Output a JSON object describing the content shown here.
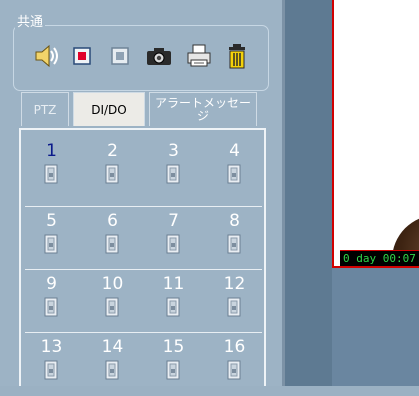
{
  "common": {
    "legend": "共通"
  },
  "toolbar": {
    "items": [
      {
        "icon": "speaker-icon"
      },
      {
        "icon": "record-start-icon"
      },
      {
        "icon": "record-stop-icon"
      },
      {
        "icon": "camera-snapshot-icon"
      },
      {
        "icon": "printer-icon"
      },
      {
        "icon": "trash-icon"
      }
    ]
  },
  "tabs": [
    {
      "label": "PTZ",
      "state": "disabled"
    },
    {
      "label": "DI/DO",
      "state": "selected"
    },
    {
      "label": "アラートメッセージ",
      "state": "normal"
    }
  ],
  "io": {
    "channels": [
      "1",
      "2",
      "3",
      "4",
      "5",
      "6",
      "7",
      "8",
      "9",
      "10",
      "11",
      "12",
      "13",
      "14",
      "15",
      "16"
    ],
    "active_channel": "1"
  },
  "video": {
    "timer": "0 day  00:07"
  },
  "colors": {
    "panel_bg": "#9db3c5",
    "active_number": "#0b1a8a",
    "video_border": "#d10000",
    "timer_text": "#2fd64a"
  }
}
